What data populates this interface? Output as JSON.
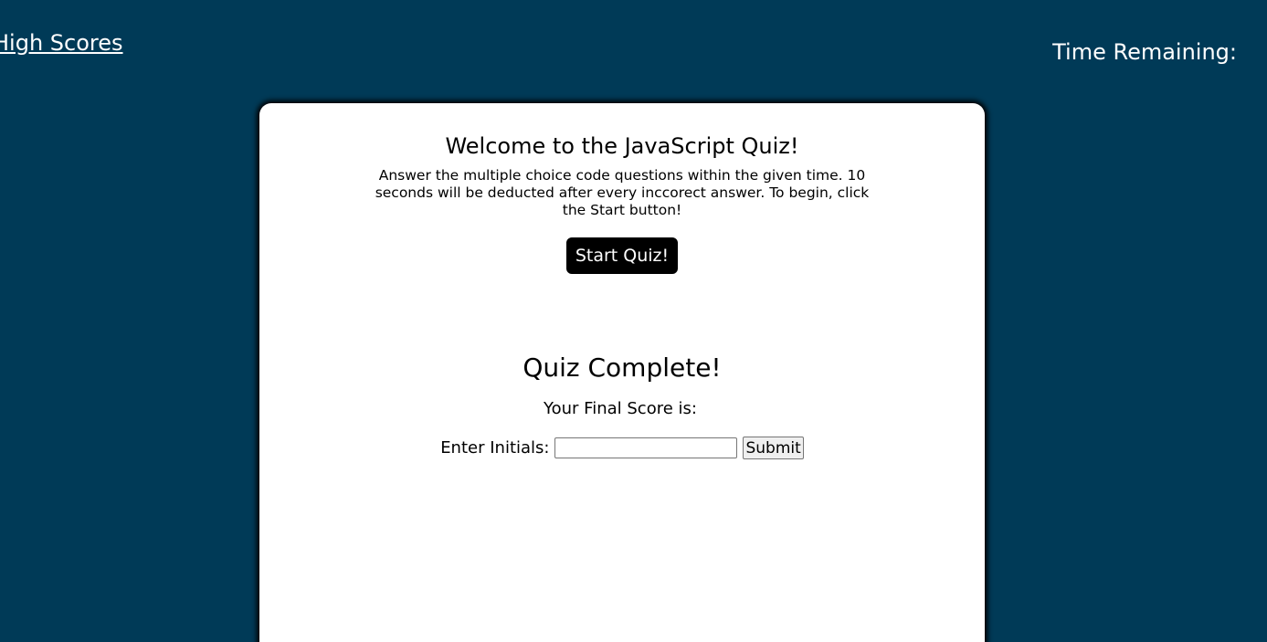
{
  "header": {
    "highscores_link": "High Scores",
    "timer_label": "Time Remaining:",
    "timer_value": ""
  },
  "start": {
    "title": "Welcome to the JavaScript Quiz!",
    "instructions": "Answer the multiple choice code questions within the given time. 10 seconds will be deducted after every inccorect answer. To begin, click the Start button!",
    "start_button": "Start Quiz!"
  },
  "complete": {
    "title": "Quiz Complete!",
    "final_score_label": "Your Final Score is:",
    "final_score_value": "",
    "initials_label": "Enter Initials:",
    "initials_value": "",
    "submit_button": "Submit"
  },
  "colors": {
    "background": "#003a57",
    "card": "#ffffff",
    "button": "#000000"
  }
}
